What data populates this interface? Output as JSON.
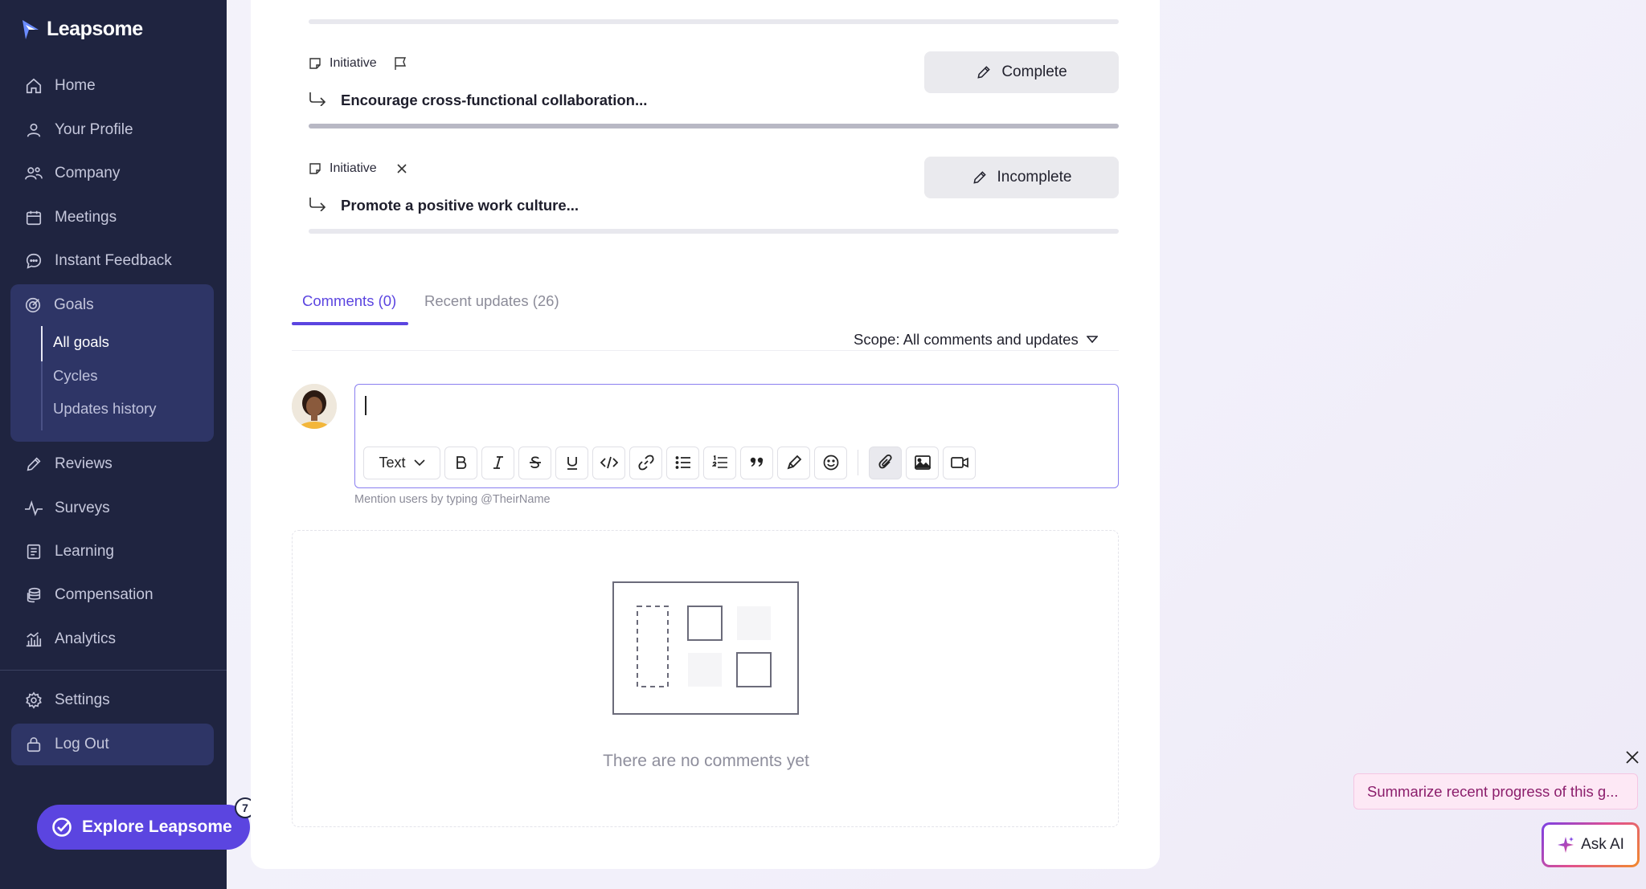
{
  "brand": {
    "name": "Leapsome"
  },
  "nav": {
    "home": "Home",
    "profile": "Your Profile",
    "company": "Company",
    "meetings": "Meetings",
    "instant_feedback": "Instant Feedback",
    "goals": "Goals",
    "goals_sub": {
      "all_goals": "All goals",
      "cycles": "Cycles",
      "updates_history": "Updates history"
    },
    "reviews": "Reviews",
    "surveys": "Surveys",
    "learning": "Learning",
    "compensation": "Compensation",
    "analytics": "Analytics",
    "settings": "Settings",
    "logout": "Log Out"
  },
  "explore": {
    "label": "Explore Leapsome",
    "badge": "7"
  },
  "initiatives": [
    {
      "type": "Initiative",
      "title": "Encourage cross-functional collaboration...",
      "action": "Complete",
      "progress": 1.0
    },
    {
      "type": "Initiative",
      "title": "Promote a positive work culture...",
      "action": "Incomplete",
      "progress": 0.0
    }
  ],
  "tabs": {
    "comments": "Comments (0)",
    "recent_updates": "Recent updates (26)"
  },
  "scope": {
    "label": "Scope: All comments and updates"
  },
  "editor": {
    "text_style": "Text",
    "hint": "Mention users by typing @TheirName"
  },
  "empty": {
    "message": "There are no comments yet"
  },
  "ai": {
    "suggestion": "Summarize recent progress of this g...",
    "button": "Ask AI"
  },
  "colors": {
    "sidebar": "#1f2440",
    "accent": "#5b45e0",
    "active_group": "#2e3566"
  }
}
